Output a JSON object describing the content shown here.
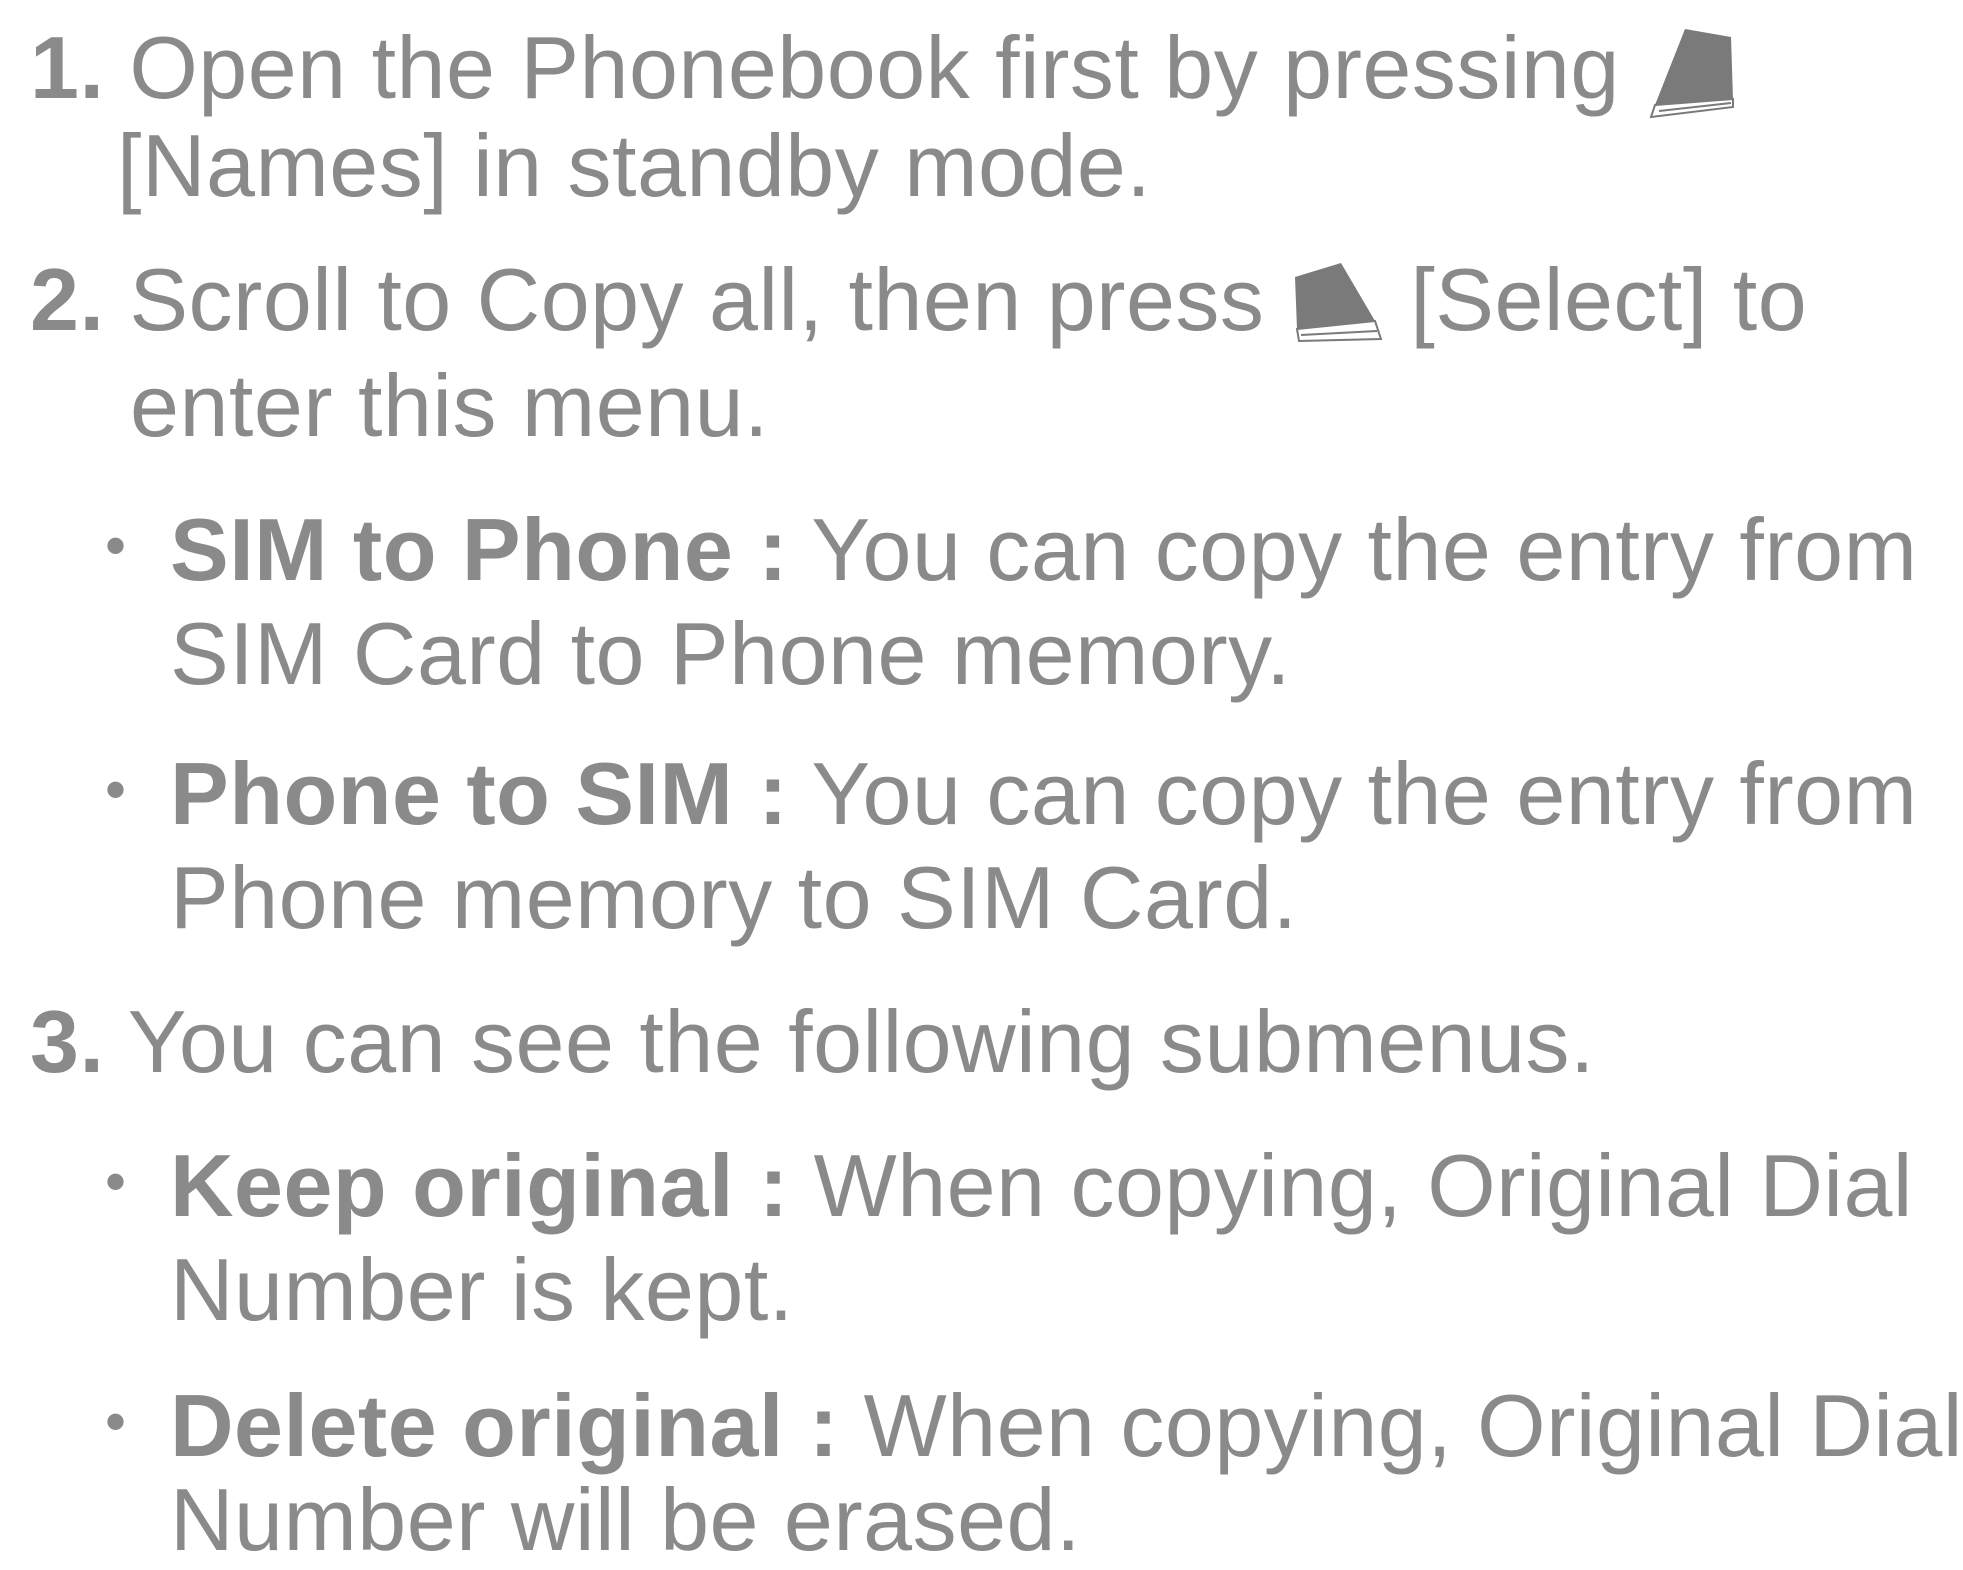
{
  "steps": [
    {
      "number": "1.",
      "line1_before": "Open the Phonebook first by pressing",
      "key_icon": "left-softkey-icon",
      "line2": "[Names] in standby mode."
    },
    {
      "number": "2.",
      "line1_before": "Scroll to Copy all, then press",
      "key_icon": "right-softkey-icon",
      "line1_after": "[Select] to",
      "line2": "enter this menu."
    },
    {
      "number": "3.",
      "line1": "You can see the following submenus."
    }
  ],
  "step2_options": [
    {
      "term": "SIM to Phone :",
      "line1": "You can copy the entry from",
      "line2": "SIM Card to Phone memory."
    },
    {
      "term": "Phone to SIM :",
      "line1": "You can copy the entry from",
      "line2": "Phone memory to SIM Card."
    }
  ],
  "step3_options": [
    {
      "term": "Keep original :",
      "line1": "When copying, Original Dial",
      "line2": "Number is kept."
    },
    {
      "term": "Delete original :",
      "line1": "When copying, Original Dial",
      "line2": "Number will be erased."
    }
  ],
  "colors": {
    "text": "#8a8a8a",
    "icon_fill": "#7a7a7a"
  }
}
